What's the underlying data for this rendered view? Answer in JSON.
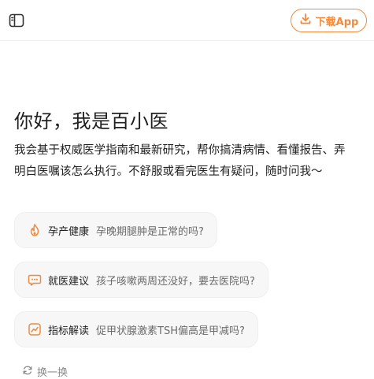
{
  "header": {
    "sidebar_icon": "sidebar-toggle-icon",
    "download_label": "下载App",
    "download_icon": "download-icon",
    "accent": "#f08a3c"
  },
  "main": {
    "greeting": "你好，我是百小医",
    "intro": "我会基于权威医学指南和最新研究，帮你搞清病情、看懂报告、弄明白医嘱该怎么执行。不舒服或看完医生有疑问，随时问我～",
    "suggestions": [
      {
        "icon": "flame-icon",
        "category": "孕产健康",
        "question": "孕晚期腿肿是正常的吗?"
      },
      {
        "icon": "chat-bubble-icon",
        "category": "就医建议",
        "question": "孩子咳嗽两周还没好，要去医院吗?"
      },
      {
        "icon": "trend-chart-icon",
        "category": "指标解读",
        "question": "促甲状腺激素TSH偏高是甲减吗?"
      }
    ],
    "refresh_label": "换一换",
    "refresh_icon": "refresh-icon"
  }
}
